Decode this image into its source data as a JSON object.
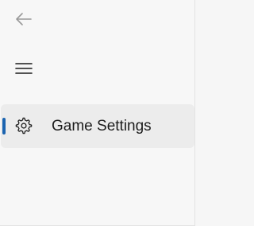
{
  "navigation": {
    "back_icon": "arrow-left-icon",
    "menu_icon": "hamburger-menu-icon",
    "items": [
      {
        "label": "Game Settings",
        "icon": "gear-icon",
        "selected": true
      }
    ]
  },
  "colors": {
    "accent": "#1b64b0",
    "pane_background": "#f7f7f7",
    "selected_item_background": "#ececec",
    "text": "#1c1c1c",
    "disabled_icon": "#9a9a9a"
  }
}
